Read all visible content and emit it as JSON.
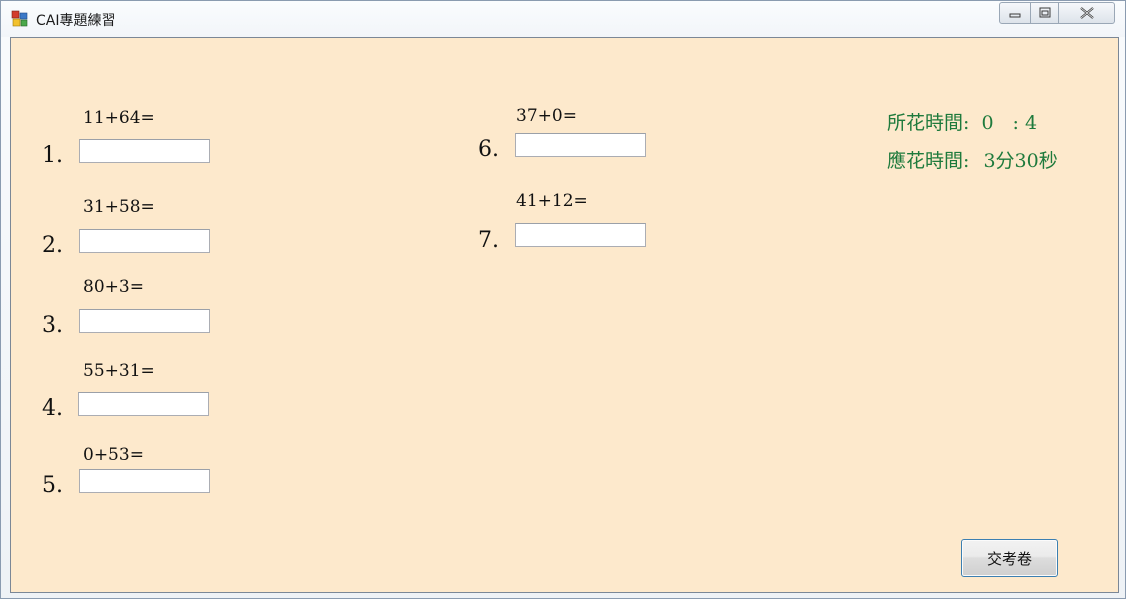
{
  "window": {
    "title": "CAI專題練習"
  },
  "questions": [
    {
      "number": "1.",
      "expression": "11+64=",
      "answer": ""
    },
    {
      "number": "2.",
      "expression": "31+58=",
      "answer": ""
    },
    {
      "number": "3.",
      "expression": "80+3=",
      "answer": ""
    },
    {
      "number": "4.",
      "expression": "55+31=",
      "answer": ""
    },
    {
      "number": "5.",
      "expression": "0+53=",
      "answer": ""
    },
    {
      "number": "6.",
      "expression": "37+0=",
      "answer": ""
    },
    {
      "number": "7.",
      "expression": "41+12=",
      "answer": ""
    }
  ],
  "timer": {
    "elapsed_label": "所花時間:",
    "elapsed_value": "0　: 4",
    "allowed_label": "應花時間:",
    "allowed_value": "3分30秒"
  },
  "submit_label": "交考卷",
  "icons": {
    "app": "app-window-icon",
    "minimize": "minimize-icon",
    "maximize": "maximize-icon",
    "close": "close-icon"
  }
}
